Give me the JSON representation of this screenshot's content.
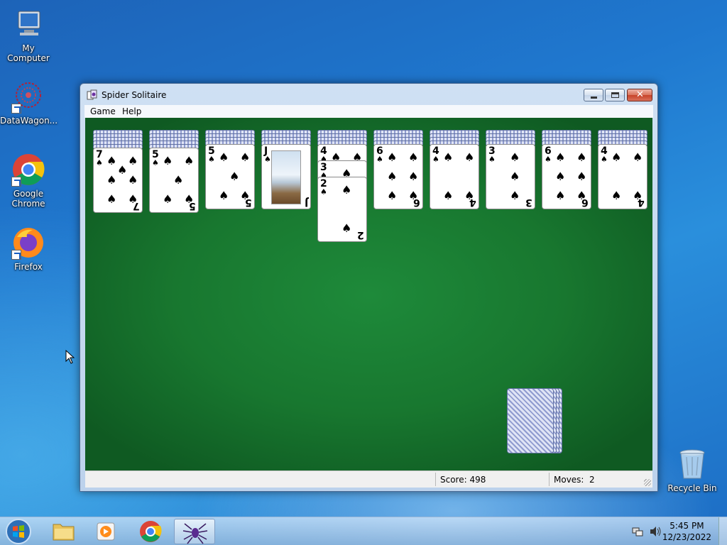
{
  "desktop": {
    "icons": [
      {
        "label": "My Computer",
        "icon": "computer-icon"
      },
      {
        "label": "DataWagon...",
        "icon": "datawagon-icon"
      },
      {
        "label": "Google Chrome",
        "icon": "chrome-icon"
      },
      {
        "label": "Firefox",
        "icon": "firefox-icon"
      },
      {
        "label": "Recycle Bin",
        "icon": "recycle-bin-icon"
      }
    ]
  },
  "window": {
    "title": "Spider Solitaire",
    "menu": [
      "Game",
      "Help"
    ],
    "status": {
      "score": "Score: 498",
      "moves_label": "Moves:",
      "moves_value": "2"
    }
  },
  "tableau": {
    "suit": "♠",
    "columns": [
      {
        "hidden": 5,
        "cards": [
          "7"
        ]
      },
      {
        "hidden": 5,
        "cards": [
          "5"
        ]
      },
      {
        "hidden": 4,
        "cards": [
          "5"
        ]
      },
      {
        "hidden": 4,
        "cards": [
          "J"
        ]
      },
      {
        "hidden": 4,
        "cards": [
          "4",
          "3",
          "2"
        ]
      },
      {
        "hidden": 4,
        "cards": [
          "6"
        ]
      },
      {
        "hidden": 4,
        "cards": [
          "4"
        ]
      },
      {
        "hidden": 4,
        "cards": [
          "3"
        ]
      },
      {
        "hidden": 4,
        "cards": [
          "6"
        ]
      },
      {
        "hidden": 4,
        "cards": [
          "4"
        ]
      }
    ],
    "stock_piles": 4
  },
  "taskbar": {
    "time": "5:45 PM",
    "date": "12/23/2022"
  },
  "colors": {
    "felt": "#18772f",
    "card_back": "#8f9bcf"
  }
}
